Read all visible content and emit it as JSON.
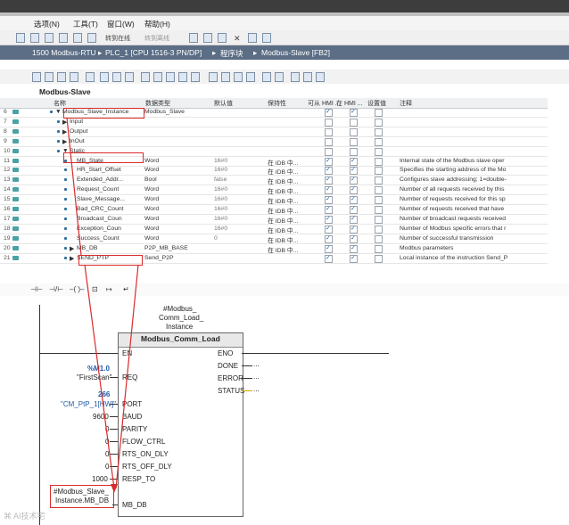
{
  "menu": {
    "items": [
      "选项(N)",
      "工具(T)",
      "窗口(W)",
      "帮助(H)"
    ],
    "toolbar_texts": [
      "转到在线",
      "转到离线"
    ]
  },
  "breadcrumb": [
    "1500 Modbus-RTU",
    "PLC_1 [CPU 1516-3 PN/DP]",
    "程序块",
    "Modbus-Slave [FB2]"
  ],
  "block": {
    "name": "Modbus-Slave"
  },
  "table": {
    "headers": [
      "名称",
      "数据类型",
      "默认值",
      "保持性",
      "可从 HMI ...",
      "在 HMI ...",
      "设置值",
      "注释"
    ],
    "rows": [
      {
        "num": "6",
        "name": "Modbus_Slave_Instance",
        "type": "Modbus_Slave",
        "default": "",
        "retain": "",
        "hmi1": true,
        "hmi2": true,
        "comment": "",
        "level": 0,
        "exp": "▼"
      },
      {
        "num": "7",
        "name": "Input",
        "type": "",
        "default": "",
        "retain": "",
        "hmi1": false,
        "hmi2": false,
        "comment": "",
        "level": 1,
        "exp": "▶"
      },
      {
        "num": "8",
        "name": "Output",
        "type": "",
        "default": "",
        "retain": "",
        "hmi1": false,
        "hmi2": false,
        "comment": "",
        "level": 1,
        "exp": "▶"
      },
      {
        "num": "9",
        "name": "InOut",
        "type": "",
        "default": "",
        "retain": "",
        "hmi1": false,
        "hmi2": false,
        "comment": "",
        "level": 1,
        "exp": "▶"
      },
      {
        "num": "10",
        "name": "Static",
        "type": "",
        "default": "",
        "retain": "",
        "hmi1": false,
        "hmi2": false,
        "comment": "",
        "level": 1,
        "exp": "▼"
      },
      {
        "num": "11",
        "name": "MB_State",
        "type": "Word",
        "default": "16#0",
        "retain": "在 IDB 中...",
        "hmi1": true,
        "hmi2": true,
        "comment": "Internal state of the Modbus slave oper",
        "level": 2,
        "exp": ""
      },
      {
        "num": "12",
        "name": "HR_Start_Offset",
        "type": "Word",
        "default": "16#0",
        "retain": "在 IDB 中...",
        "hmi1": true,
        "hmi2": true,
        "comment": "Specifies the starting address of the Mo",
        "level": 2,
        "exp": ""
      },
      {
        "num": "13",
        "name": "Extended_Addr...",
        "type": "Bool",
        "default": "false",
        "retain": "在 IDB 中...",
        "hmi1": true,
        "hmi2": true,
        "comment": "Configures slave addressing; 1=double-",
        "level": 2,
        "exp": ""
      },
      {
        "num": "14",
        "name": "Request_Count",
        "type": "Word",
        "default": "16#0",
        "retain": "在 IDB 中...",
        "hmi1": true,
        "hmi2": true,
        "comment": "Number of all requests received by this",
        "level": 2,
        "exp": ""
      },
      {
        "num": "15",
        "name": "Slave_Message...",
        "type": "Word",
        "default": "16#0",
        "retain": "在 IDB 中...",
        "hmi1": true,
        "hmi2": true,
        "comment": "Number of requests received for this sp",
        "level": 2,
        "exp": ""
      },
      {
        "num": "16",
        "name": "Bad_CRC_Count",
        "type": "Word",
        "default": "16#0",
        "retain": "在 IDB 中...",
        "hmi1": true,
        "hmi2": true,
        "comment": "Number of requests received that have",
        "level": 2,
        "exp": ""
      },
      {
        "num": "17",
        "name": "Broadcast_Coun",
        "type": "Word",
        "default": "16#0",
        "retain": "在 IDB 中...",
        "hmi1": true,
        "hmi2": true,
        "comment": "Number of broadcast requests received",
        "level": 2,
        "exp": ""
      },
      {
        "num": "18",
        "name": "Exception_Coun",
        "type": "Word",
        "default": "16#0",
        "retain": "在 IDB 中...",
        "hmi1": true,
        "hmi2": true,
        "comment": "Number of Modbus specific errors that r",
        "level": 2,
        "exp": ""
      },
      {
        "num": "19",
        "name": "Success_Count",
        "type": "Word",
        "default": "0",
        "retain": "在 IDB 中...",
        "hmi1": true,
        "hmi2": true,
        "comment": "Number of successful transmission",
        "level": 2,
        "exp": ""
      },
      {
        "num": "20",
        "name": "MB_DB",
        "type": "P2P_MB_BASE",
        "default": "",
        "retain": "在 IDB 中...",
        "hmi1": true,
        "hmi2": true,
        "comment": "Modbus parameters",
        "level": 2,
        "exp": "▶"
      },
      {
        "num": "21",
        "name": "SEND_PTP",
        "type": "Send_P2P",
        "default": "",
        "retain": "",
        "hmi1": true,
        "hmi2": true,
        "comment": "Local instance of the instruction Send_P",
        "level": 2,
        "exp": "▶"
      }
    ]
  },
  "ladder": {
    "tools": [
      "⊣⊢",
      "⊣/⊢",
      "–( )–",
      "⊡",
      "↦",
      "↵"
    ],
    "instance_label": [
      "#Modbus_",
      "Comm_Load_",
      "Instance"
    ],
    "block_title": "Modbus_Comm_Load",
    "left_pins": [
      "EN",
      "REQ",
      "PORT",
      "BAUD",
      "PARITY",
      "FLOW_CTRL",
      "RTS_ON_DLY",
      "RTS_OFF_DLY",
      "RESP_TO",
      "MB_DB"
    ],
    "right_pins": [
      "ENO",
      "DONE",
      "ERROR",
      "STATUS"
    ],
    "right_dashes": [
      "...",
      "...",
      "..."
    ],
    "inputs": {
      "req_addr": "%M1.0",
      "req_tag": "\"FirstScan\"",
      "port_val": "266",
      "port_tag": "\"CM_PtP_1[HW]\"",
      "baud": "9600",
      "parity": "0",
      "flow": "0",
      "rts_on": "0",
      "rts_off": "0",
      "resp_to": "1000",
      "mb_db": [
        "#Modbus_Slave_",
        "Instance.MB_DB"
      ]
    }
  },
  "watermark": "AI技术宅"
}
